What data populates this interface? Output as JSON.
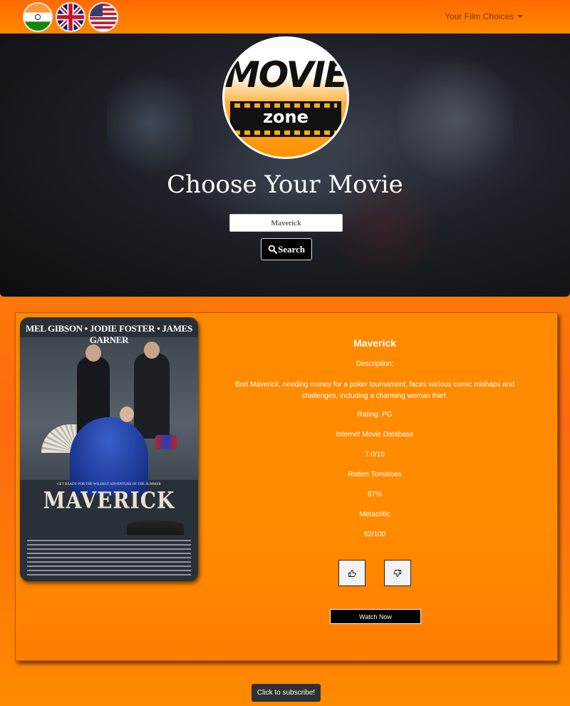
{
  "nav": {
    "flags": [
      {
        "name": "india-flag-icon",
        "label": "India"
      },
      {
        "name": "uk-flag-icon",
        "label": "United Kingdom"
      },
      {
        "name": "usa-flag-icon",
        "label": "United States"
      }
    ],
    "dropdown_label": "Your Film Choices"
  },
  "hero": {
    "logo_title": "MOVIE",
    "logo_subtitle": "zone",
    "title": "Choose Your Movie",
    "search_value": "Maverick",
    "search_button_label": "Search"
  },
  "poster": {
    "cast": "MEL GIBSON • JODIE FOSTER • JAMES GARNER",
    "title": "MAVERICK",
    "tagline": "GET READY FOR THE WILDEST ADVENTURE OF THE SUMMER"
  },
  "movie": {
    "title": "Maverick",
    "description_label": "Description:",
    "plot": "Bret Maverick, needing money for a poker tournament, faces various comic mishaps and challenges, including a charming woman thief.",
    "rating": "Rating: PG",
    "imdb_label": "Internet Movie Database",
    "imdb_value": "7.0/10",
    "rt_label": "Rotten Tomatoes",
    "rt_value": "67%",
    "mc_label": "Metacritic",
    "mc_value": "62/100",
    "watch_label": "Watch Now"
  },
  "footer": {
    "subscribe_label": "Click to subscribe!"
  },
  "colors": {
    "accent": "#ff8a00",
    "hero_bg": "#1d2026",
    "button_dark": "#000000"
  }
}
